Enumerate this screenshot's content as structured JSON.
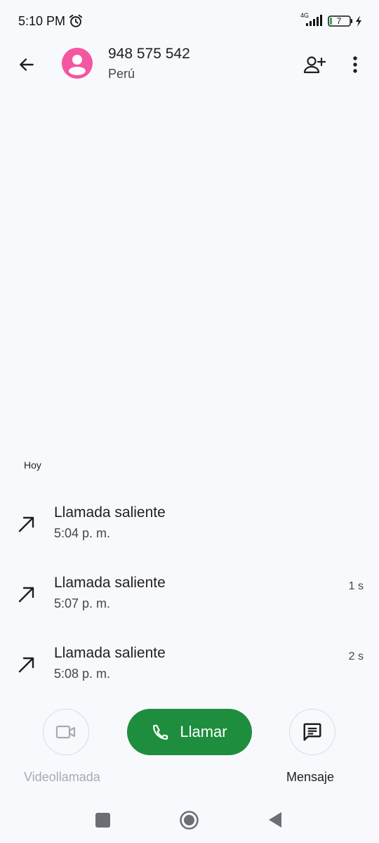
{
  "status_bar": {
    "time": "5:10 PM",
    "network": "4G",
    "battery": "7",
    "icons": [
      "alarm-icon",
      "signal-icon",
      "battery-icon",
      "charging-icon"
    ]
  },
  "header": {
    "number": "948 575 542",
    "region": "Perú",
    "avatar_color": "#f4569f",
    "icons": [
      "back-arrow-icon",
      "add-contact-icon",
      "more-vert-icon"
    ]
  },
  "history": {
    "section": "Hoy",
    "calls": [
      {
        "type": "Llamada saliente",
        "time": "5:04 p. m.",
        "duration": ""
      },
      {
        "type": "Llamada saliente",
        "time": "5:07 p. m.",
        "duration": "1 s"
      },
      {
        "type": "Llamada saliente",
        "time": "5:08 p. m.",
        "duration": "2 s"
      }
    ]
  },
  "actions": {
    "video_label": "Videollamada",
    "call_label": "Llamar",
    "message_label": "Mensaje",
    "call_color": "#1e8e3e"
  }
}
